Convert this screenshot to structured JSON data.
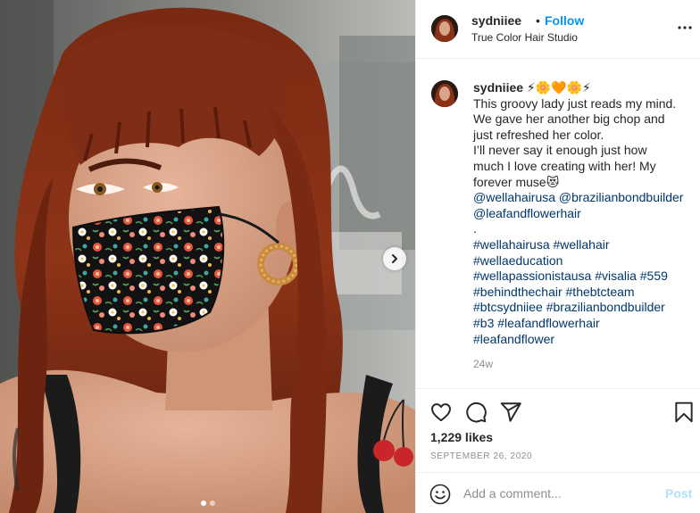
{
  "post": {
    "username": "sydniiee",
    "follow_bullet": "•",
    "follow_label": "Follow",
    "location": "True Color Hair Studio",
    "more_icon": "more-horizontal-icon"
  },
  "caption": {
    "username": "sydniiee",
    "username_emojis": "⚡🌼🧡🌼⚡",
    "lines": [
      "This groovy lady just reads my mind.",
      "We gave her another big chop and",
      "just refreshed her color.",
      "I’ll never say it enough just how",
      "much I love creating with her! My",
      "forever muse😻"
    ],
    "mention_lines": [
      "@wellahairusa @brazilianbondbuilder",
      "@leafandflowerhair"
    ],
    "separator": ".",
    "hashtag_lines": [
      "#wellahairusa #wellahair",
      "#wellaeducation",
      "#wellapassionistausa #visalia #559",
      "#behindthechair #thebtcteam",
      "#btcsydniiee #brazilianbondbuilder",
      "#b3 #leafandflowerhair",
      "#leafandflower"
    ],
    "time_ago": "24w"
  },
  "actions": {
    "like_icon": "heart-icon",
    "comment_icon": "comment-icon",
    "share_icon": "share-icon",
    "save_icon": "bookmark-icon",
    "likes": "1,229 likes",
    "date": "SEPTEMBER 26, 2020"
  },
  "comment_box": {
    "placeholder": "Add a comment...",
    "value": "",
    "post_label": "Post",
    "emoji_icon": "smiley-icon"
  },
  "media": {
    "next_icon": "chevron-right-icon",
    "carousel_count": 2,
    "carousel_active": 1
  },
  "colors": {
    "link": "#00376b",
    "follow": "#0095f6",
    "post_disabled": "#b2dffc",
    "muted": "#8e8e8e"
  }
}
